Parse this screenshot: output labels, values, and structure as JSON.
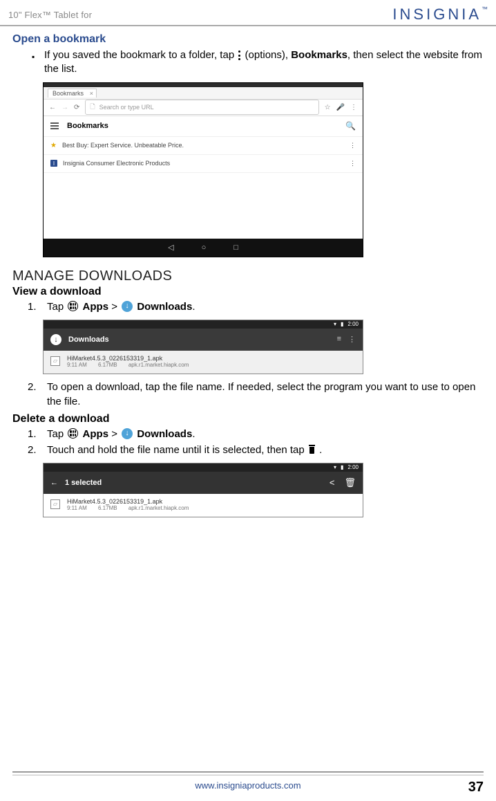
{
  "header": {
    "product": "10\" Flex™ Tablet for",
    "brand": "INSIGNIA"
  },
  "open_bookmark": {
    "title": "Open a bookmark",
    "bullet_pre": "If you saved the bookmark to a folder, tap ",
    "bullet_mid": " (options), ",
    "bullet_bold": "Bookmarks",
    "bullet_post": ", then select the website from the list."
  },
  "ss1": {
    "tab": "Bookmarks",
    "url_placeholder": "Search or type URL",
    "section": "Bookmarks",
    "row1": "Best Buy: Expert Service. Unbeatable Price.",
    "row2": "Insignia Consumer Electronic Products"
  },
  "manage": {
    "title": "MANAGE DOWNLOADS"
  },
  "view_dl": {
    "title": "View a download",
    "step1_pre": "Tap ",
    "apps": "Apps",
    "gt": " > ",
    "downloads": "Downloads",
    "dot": ".",
    "step2": "To open a download, tap the file name. If needed, select the program you want to use to open the file."
  },
  "ss2": {
    "time": "2:00",
    "header": "Downloads",
    "file": "HiMarket4.5.3_0226153319_1.apk",
    "meta_time": "9:11 AM",
    "meta_size": "6.17MB",
    "meta_src": "apk.r1.market.hiapk.com"
  },
  "delete_dl": {
    "title": "Delete a download",
    "step1_pre": "Tap ",
    "apps": "Apps",
    "gt": " > ",
    "downloads": "Downloads",
    "dot": ".",
    "step2_pre": "Touch and hold the file name until it is selected, then tap ",
    "step2_post": "."
  },
  "ss3": {
    "time": "2:00",
    "header": "1 selected",
    "file": "HiMarket4.5.3_0226153319_1.apk",
    "meta_time": "9:11 AM",
    "meta_size": "6.17MB",
    "meta_src": "apk.r1.market.hiapk.com"
  },
  "footer": {
    "url": "www.insigniaproducts.com",
    "page": "37"
  }
}
